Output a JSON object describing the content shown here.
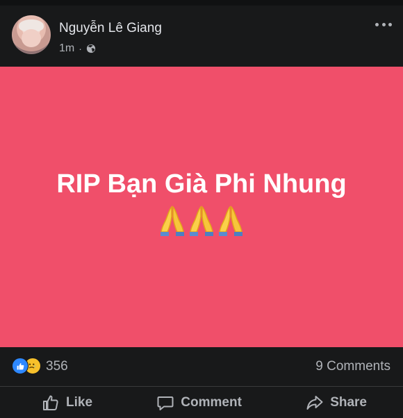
{
  "post": {
    "author": "Nguyễn Lê Giang",
    "time": "1m",
    "separator": "·",
    "privacy_icon": "globe-icon",
    "menu_icon": "more-options-icon",
    "card_background": "#f04f6a",
    "card_text": "RIP Bạn Già Phi Nhung",
    "card_emoji": [
      "folded-hands",
      "folded-hands",
      "folded-hands"
    ]
  },
  "reactions": {
    "types": [
      "like",
      "sad"
    ],
    "count": "356",
    "comments": "9 Comments"
  },
  "actions": {
    "like_label": "Like",
    "comment_label": "Comment",
    "share_label": "Share"
  },
  "colors": {
    "background": "#18191a",
    "text_primary": "#e4e6eb",
    "text_secondary": "#b0b3b8",
    "like_blue": "#2d88ff",
    "sad_yellow": "#f7c02b"
  }
}
